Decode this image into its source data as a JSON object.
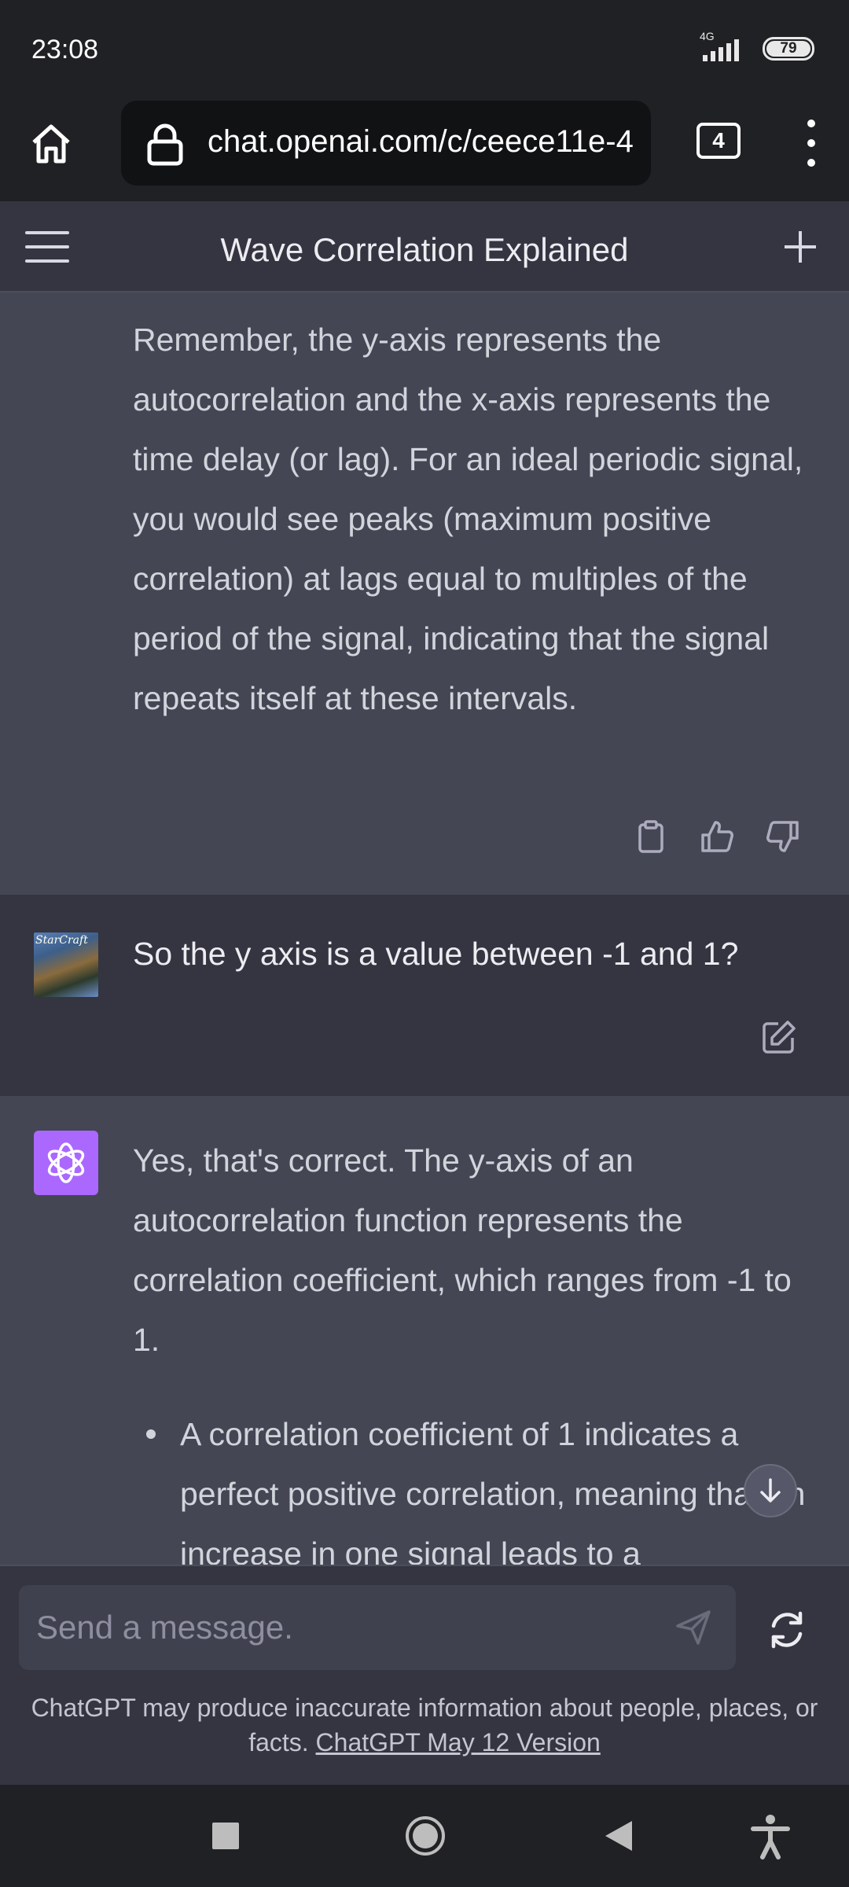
{
  "status_bar": {
    "time": "23:08",
    "network": "4G",
    "battery": "79"
  },
  "browser": {
    "url": "chat.openai.com/c/ceece11e-4",
    "tab_count": "4"
  },
  "chat": {
    "title": "Wave Correlation Explained",
    "messages": [
      {
        "role": "assistant",
        "text": "Remember, the y-axis represents the autocorrelation and the x-axis represents the time delay (or lag). For an ideal periodic signal, you would see peaks (maximum positive correlation) at lags equal to multiples of the period of the signal, indicating that the signal repeats itself at these intervals."
      },
      {
        "role": "user",
        "text": "So the y axis is a value between -1 and 1?",
        "avatar_text": "StarCraft"
      },
      {
        "role": "assistant",
        "text": "Yes, that's correct. The y-axis of an autocorrelation function represents the correlation coefficient, which ranges from -1 to 1.",
        "bullet": "A correlation coefficient of 1 indicates a perfect positive correlation, meaning that an increase in one signal leads to a"
      }
    ]
  },
  "composer": {
    "placeholder": "Send a message.",
    "disclaimer": "ChatGPT may produce inaccurate information about people, places, or facts.",
    "version_link": "ChatGPT May 12 Version"
  },
  "colors": {
    "accent": "#ab68ff",
    "background": "#343541",
    "assistant_bg": "#444654",
    "system_bar": "#202124"
  },
  "icons": [
    "home-icon",
    "lock-icon",
    "tabs-icon",
    "more-icon",
    "menu-icon",
    "plus-icon",
    "copy-icon",
    "thumbs-up-icon",
    "thumbs-down-icon",
    "edit-icon",
    "openai-logo-icon",
    "arrow-down-icon",
    "send-icon",
    "regenerate-icon",
    "recent-apps-icon",
    "home-nav-icon",
    "back-icon",
    "accessibility-icon"
  ]
}
